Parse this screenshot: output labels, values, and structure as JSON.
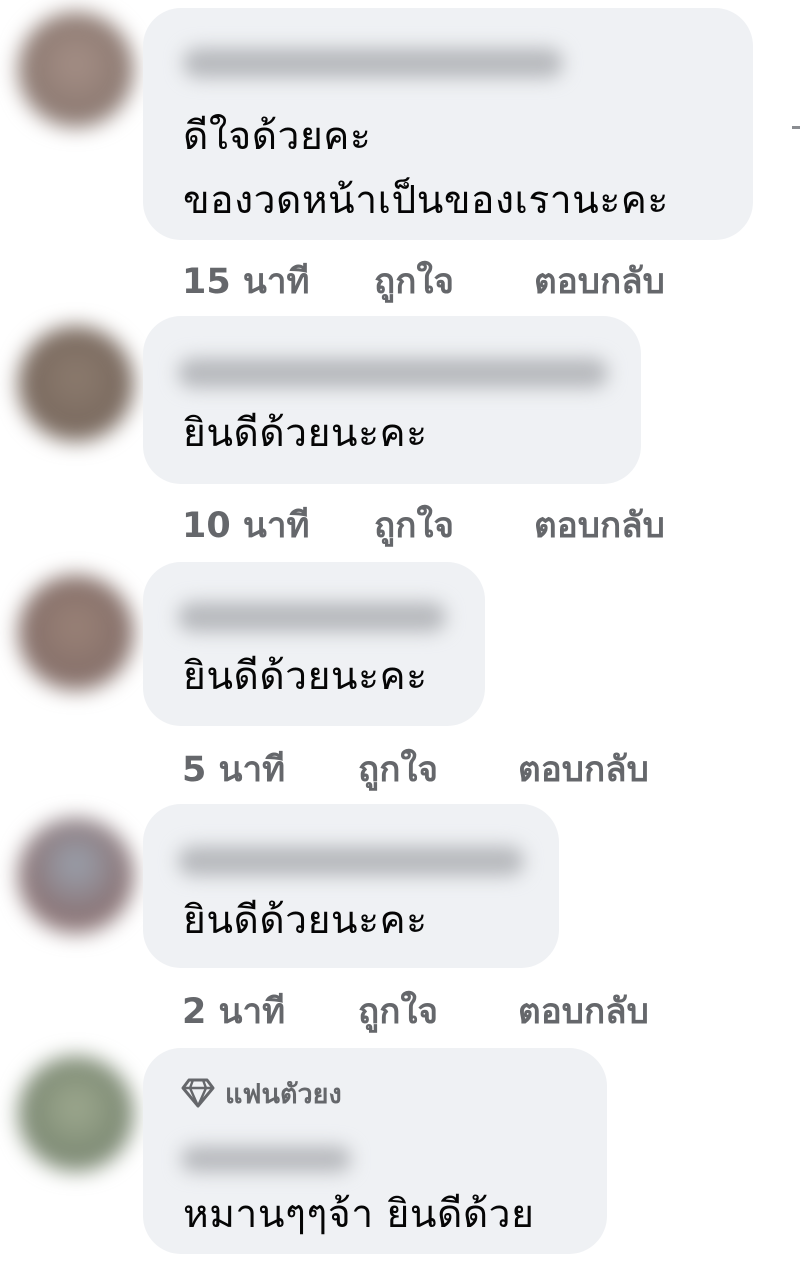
{
  "comments": [
    {
      "lines": [
        "ดีใจด้วยคะ",
        "ของวดหน้าเป็นของเรานะคะ"
      ],
      "time": "15 นาที",
      "like": "ถูกใจ",
      "reply": "ตอบกลับ"
    },
    {
      "lines": [
        "ยินดีด้วยนะคะ"
      ],
      "time": "10 นาที",
      "like": "ถูกใจ",
      "reply": "ตอบกลับ"
    },
    {
      "lines": [
        "ยินดีด้วยนะคะ"
      ],
      "time": "5 นาที",
      "like": "ถูกใจ",
      "reply": "ตอบกลับ"
    },
    {
      "lines": [
        "ยินดีด้วยนะคะ"
      ],
      "time": "2 นาที",
      "like": "ถูกใจ",
      "reply": "ตอบกลับ"
    },
    {
      "badge": "แฟนตัวยง",
      "badge_icon": "diamond-icon",
      "lines": [
        "หมานๆๆจ้า ยินดีด้วย"
      ]
    }
  ]
}
